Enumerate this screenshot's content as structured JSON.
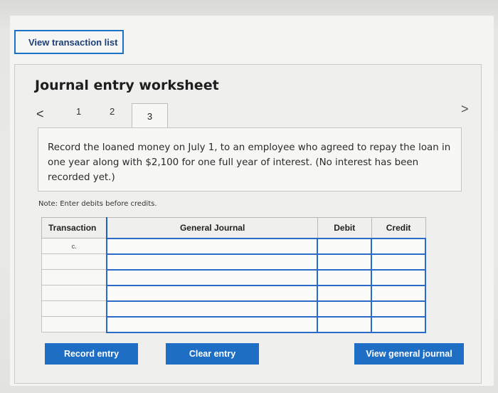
{
  "header": {
    "view_transaction_list": "View transaction list"
  },
  "worksheet": {
    "title": "Journal entry worksheet",
    "nav_prev": "<",
    "nav_next": ">",
    "tabs": [
      "1",
      "2",
      "3"
    ],
    "active_tab": "3",
    "prompt": "Record the loaned money on July 1, to an employee who agreed to repay the loan in one year along with $2,100 for one full year of interest. (No interest has been recorded yet.)",
    "note": "Note: Enter debits before credits.",
    "table": {
      "headers": [
        "Transaction",
        "General Journal",
        "Debit",
        "Credit"
      ],
      "rows": [
        {
          "transaction": "c.",
          "general_journal": "",
          "debit": "",
          "credit": ""
        },
        {
          "transaction": "",
          "general_journal": "",
          "debit": "",
          "credit": ""
        },
        {
          "transaction": "",
          "general_journal": "",
          "debit": "",
          "credit": ""
        },
        {
          "transaction": "",
          "general_journal": "",
          "debit": "",
          "credit": ""
        },
        {
          "transaction": "",
          "general_journal": "",
          "debit": "",
          "credit": ""
        },
        {
          "transaction": "",
          "general_journal": "",
          "debit": "",
          "credit": ""
        }
      ]
    },
    "buttons": {
      "record_entry": "Record entry",
      "clear_entry": "Clear entry",
      "view_general_journal": "View general journal"
    }
  },
  "colors": {
    "accent": "#1d6ec4",
    "input_border": "#2a6bc7"
  }
}
